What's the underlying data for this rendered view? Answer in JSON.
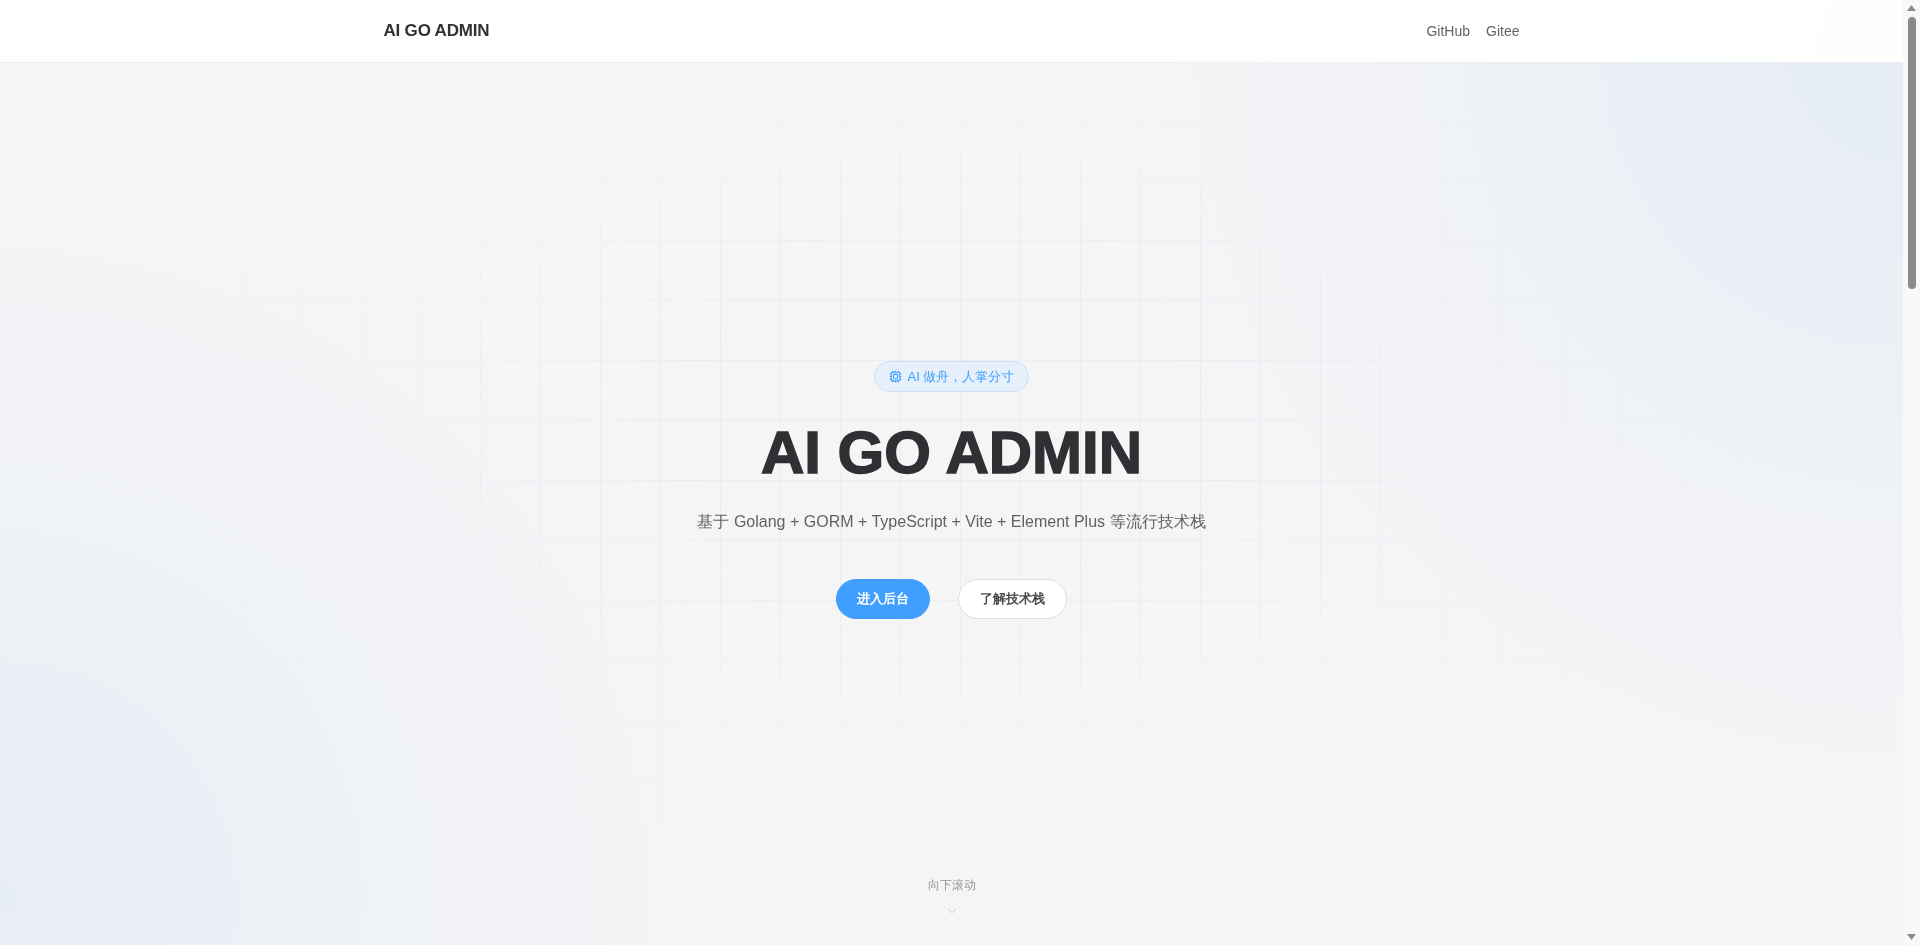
{
  "header": {
    "logo": "AI GO ADMIN",
    "nav_links": [
      "GitHub",
      "Gitee"
    ]
  },
  "hero": {
    "badge": "AI 做舟，人掌分寸",
    "title": "AI GO ADMIN",
    "subtitle": "基于 Golang + GORM + TypeScript + Vite + Element Plus 等流行技术栈",
    "buttons": [
      {
        "label": "进入后台",
        "kind": "primary"
      },
      {
        "label": "了解技术栈",
        "kind": "secondary"
      }
    ]
  },
  "scroll_hint": {
    "label": "向下滚动"
  }
}
